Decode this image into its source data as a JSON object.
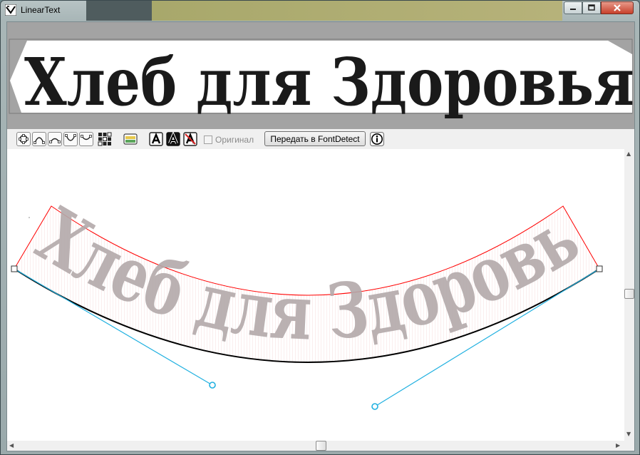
{
  "window": {
    "title": "LinearText",
    "controls": {
      "minimize": "minimize",
      "maximize": "maximize",
      "close": "close"
    }
  },
  "preview": {
    "text": "Хлеб для Здоровья"
  },
  "toolbar": {
    "shape_icons": [
      "circle-shape-icon",
      "arc-up-icon",
      "arc-up-small-icon",
      "arc-down-icon",
      "arc-down-small-icon",
      "grid-icon",
      "image-icon"
    ],
    "font_icons": [
      "font-a-icon",
      "font-a-bold-icon",
      "font-a-red-icon"
    ],
    "original_label": "Оригинал",
    "original_checked": false,
    "send_button": "Передать в FontDetect",
    "info_icon": "info-icon"
  },
  "canvas": {
    "text": "Хлеб для Здоровья",
    "text_color": "#b3a9aa",
    "guide_color": "#ff0000",
    "handle_color": "#1fb0e0"
  },
  "colors": {
    "window_frame": "#a8b6b7",
    "toolbar": "#f0f0f0"
  }
}
